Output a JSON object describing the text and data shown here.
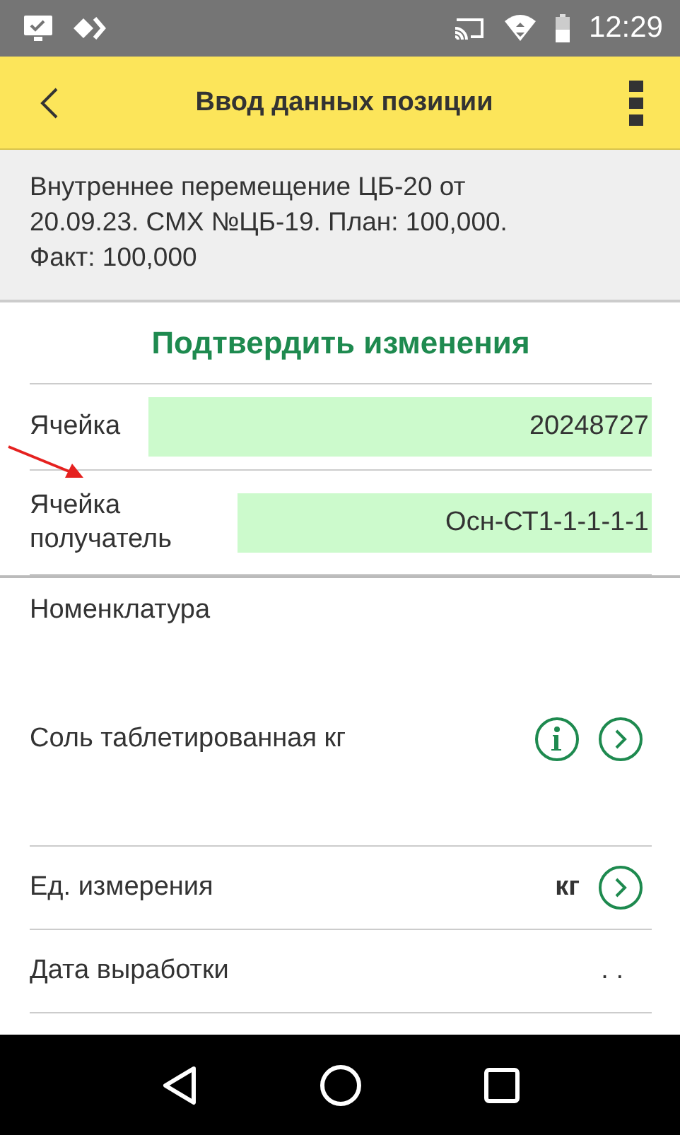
{
  "status_bar": {
    "time": "12:29"
  },
  "toolbar": {
    "title": "Ввод данных позиции"
  },
  "info": {
    "text": "Внутреннее перемещение ЦБ-20 от 20.09.23. СМХ №ЦБ-19. План: 100,000. Факт: 100,000"
  },
  "confirm_button": {
    "label": "Подтвердить изменения"
  },
  "fields": [
    {
      "label": "Ячейка",
      "value": "20248727",
      "kind": "cell"
    },
    {
      "label": "Ячейка получатель",
      "value": "Осн-СТ1-1-1-1-1",
      "kind": "cell-wide-label"
    }
  ],
  "nomenclature": {
    "label": "Номенклатура",
    "value": "Соль таблетированная кг"
  },
  "unit": {
    "label": "Ед. измерения",
    "value": "кг"
  },
  "production_date": {
    "label": "Дата выработки",
    "value": ". ."
  }
}
